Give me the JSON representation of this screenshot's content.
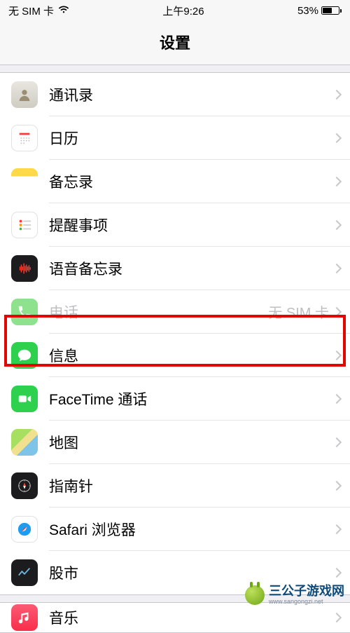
{
  "status_bar": {
    "carrier": "无 SIM 卡",
    "time": "上午9:26",
    "battery_pct": "53%"
  },
  "header": {
    "title": "设置"
  },
  "groups": [
    {
      "items": [
        {
          "id": "contacts",
          "icon": "contacts-icon",
          "label": "通讯录",
          "detail": "",
          "disabled": false
        },
        {
          "id": "calendar",
          "icon": "calendar-icon",
          "label": "日历",
          "detail": "",
          "disabled": false
        },
        {
          "id": "notes",
          "icon": "notes-icon",
          "label": "备忘录",
          "detail": "",
          "disabled": false
        },
        {
          "id": "reminders",
          "icon": "reminders-icon",
          "label": "提醒事项",
          "detail": "",
          "disabled": false
        },
        {
          "id": "voicememos",
          "icon": "voicememos-icon",
          "label": "语音备忘录",
          "detail": "",
          "disabled": false
        },
        {
          "id": "phone",
          "icon": "phone-icon",
          "label": "电话",
          "detail": "无 SIM 卡",
          "disabled": true
        },
        {
          "id": "messages",
          "icon": "messages-icon",
          "label": "信息",
          "detail": "",
          "disabled": false
        },
        {
          "id": "facetime",
          "icon": "facetime-icon",
          "label": "FaceTime 通话",
          "detail": "",
          "disabled": false
        },
        {
          "id": "maps",
          "icon": "maps-icon",
          "label": "地图",
          "detail": "",
          "disabled": false
        },
        {
          "id": "compass",
          "icon": "compass-icon",
          "label": "指南针",
          "detail": "",
          "disabled": false
        },
        {
          "id": "safari",
          "icon": "safari-icon",
          "label": "Safari 浏览器",
          "detail": "",
          "disabled": false
        },
        {
          "id": "stocks",
          "icon": "stocks-icon",
          "label": "股市",
          "detail": "",
          "disabled": false
        }
      ]
    },
    {
      "items": [
        {
          "id": "music",
          "icon": "music-icon",
          "label": "音乐",
          "detail": "",
          "disabled": false
        }
      ]
    }
  ],
  "highlighted_item": "messages",
  "watermark": {
    "brand": "三公子游戏网",
    "domain": "www.sangongzi.net"
  },
  "colors": {
    "highlight_border": "#e10600",
    "bg": "#efeff4",
    "separator": "#c8c7cc",
    "chevron": "#c7c7cc"
  }
}
